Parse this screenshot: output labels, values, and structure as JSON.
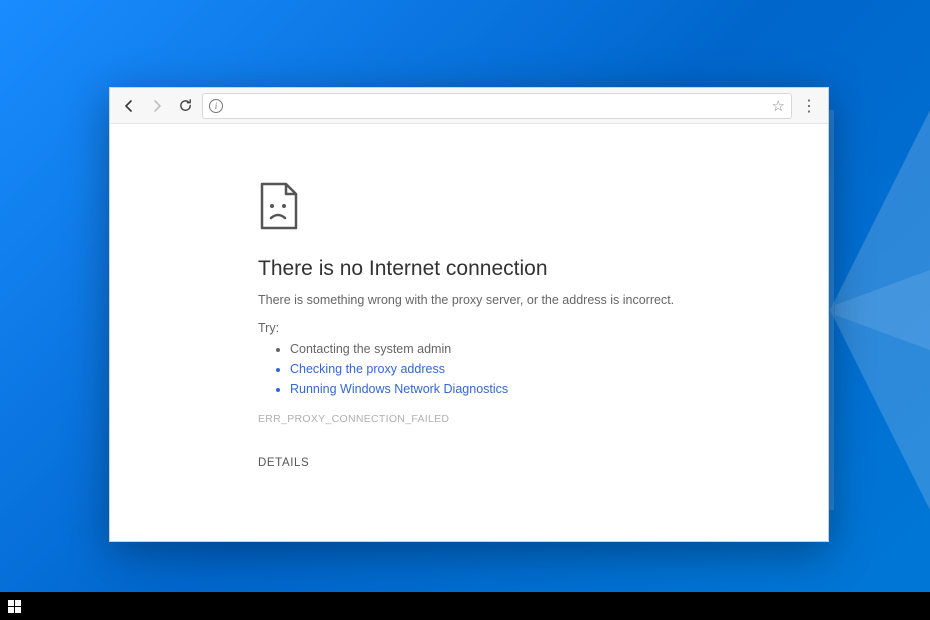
{
  "toolbar": {
    "address_value": "",
    "address_placeholder": ""
  },
  "error": {
    "title": "There is no Internet connection",
    "description": "There is something wrong with the proxy server, or the address is incorrect.",
    "try_label": "Try:",
    "suggestions": [
      {
        "text": "Contacting the system admin",
        "link": false
      },
      {
        "text": "Checking the proxy address",
        "link": true
      },
      {
        "text": "Running Windows Network Diagnostics",
        "link": true
      }
    ],
    "code": "ERR_PROXY_CONNECTION_FAILED",
    "details_label": "DETAILS"
  }
}
